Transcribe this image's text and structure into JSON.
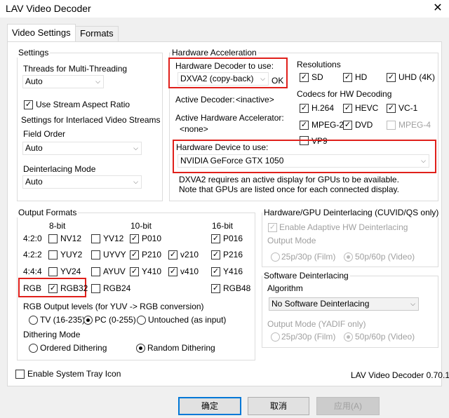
{
  "window": {
    "title": "LAV Video Decoder"
  },
  "tabs": [
    {
      "label": "Video Settings"
    },
    {
      "label": "Formats"
    }
  ],
  "settings": {
    "title": "Settings",
    "threads_label": "Threads for Multi-Threading",
    "threads_value": "Auto",
    "stream_aspect_label": "Use Stream Aspect Ratio",
    "interlaced_title": "Settings for Interlaced Video Streams",
    "field_order_label": "Field Order",
    "field_order_value": "Auto",
    "deinterlacing_mode_label": "Deinterlacing Mode",
    "deinterlacing_mode_value": "Auto"
  },
  "hw_accel": {
    "title": "Hardware Acceleration",
    "decoder_label": "Hardware Decoder to use:",
    "decoder_value": "DXVA2 (copy-back)",
    "decoder_status": "OK",
    "active_decoder_label": "Active Decoder:",
    "active_decoder_value": "<inactive>",
    "active_accel_label": "Active Hardware Accelerator:",
    "active_accel_value": "<none>",
    "device_label": "Hardware Device to use:",
    "device_value": "NVIDIA GeForce GTX 1050",
    "note_line1": "DXVA2 requires an active display for GPUs to be available.",
    "note_line2": "Note that GPUs are listed once for each connected display.",
    "resolutions_title": "Resolutions",
    "resolutions": [
      {
        "label": "SD"
      },
      {
        "label": "HD"
      },
      {
        "label": "UHD (4K)"
      }
    ],
    "codecs_title": "Codecs for HW Decoding",
    "codecs": [
      {
        "label": "H.264"
      },
      {
        "label": "HEVC"
      },
      {
        "label": "VC-1"
      },
      {
        "label": "MPEG-2"
      },
      {
        "label": "DVD"
      },
      {
        "label": "MPEG-4"
      },
      {
        "label": "VP9"
      }
    ]
  },
  "output_formats": {
    "title": "Output Formats",
    "col_headers": [
      "8-bit",
      "10-bit",
      "16-bit"
    ],
    "row_labels": [
      "4:2:0",
      "4:2:2",
      "4:4:4",
      "RGB"
    ],
    "formats": {
      "nv12": "NV12",
      "yv12": "YV12",
      "p010": "P010",
      "p016": "P016",
      "yuy2": "YUY2",
      "uyvy": "UYVY",
      "p210": "P210",
      "v210": "v210",
      "p216": "P216",
      "yv24": "YV24",
      "ayuv": "AYUV",
      "y410": "Y410",
      "v410": "v410",
      "y416": "Y416",
      "rgb32": "RGB32",
      "rgb24": "RGB24",
      "rgb48": "RGB48"
    },
    "rgb_levels_label": "RGB Output levels (for YUV -> RGB conversion)",
    "rgb_levels": [
      {
        "label": "TV (16-235)"
      },
      {
        "label": "PC (0-255)"
      },
      {
        "label": "Untouched (as input)"
      }
    ],
    "dithering_label": "Dithering Mode",
    "dithering": [
      {
        "label": "Ordered Dithering"
      },
      {
        "label": "Random Dithering"
      }
    ]
  },
  "hw_deint": {
    "title": "Hardware/GPU Deinterlacing (CUVID/QS only)",
    "enable_label": "Enable Adaptive HW Deinterlacing",
    "output_mode_label": "Output Mode",
    "options": [
      {
        "label": "25p/30p (Film)"
      },
      {
        "label": "50p/60p (Video)"
      }
    ]
  },
  "sw_deint": {
    "title": "Software Deinterlacing",
    "algorithm_label": "Algorithm",
    "algorithm_value": "No Software Deinterlacing",
    "output_mode_label": "Output Mode (YADIF only)",
    "options": [
      {
        "label": "25p/30p (Film)"
      },
      {
        "label": "50p/60p (Video)"
      }
    ]
  },
  "footer": {
    "tray_icon_label": "Enable System Tray Icon",
    "version": "LAV Video Decoder 0.70.1",
    "ok_label": "确定",
    "cancel_label": "取消",
    "apply_label": "应用(A)"
  },
  "check_mark": "✓",
  "colors": {
    "highlight_box": "#e0201b",
    "default_button_border": "#0078d7"
  }
}
